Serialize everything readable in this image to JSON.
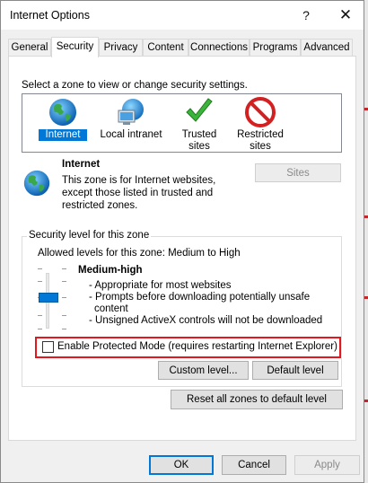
{
  "window": {
    "title": "Internet Options",
    "help_glyph": "?",
    "close_glyph": "✕"
  },
  "tabs": [
    {
      "label": "General",
      "active": false
    },
    {
      "label": "Security",
      "active": true
    },
    {
      "label": "Privacy",
      "active": false
    },
    {
      "label": "Content",
      "active": false
    },
    {
      "label": "Connections",
      "active": false
    },
    {
      "label": "Programs",
      "active": false
    },
    {
      "label": "Advanced",
      "active": false
    }
  ],
  "zone_prompt": "Select a zone to view or change security settings.",
  "zones": [
    {
      "label": "Internet",
      "icon": "globe-icon",
      "selected": true
    },
    {
      "label": "Local intranet",
      "icon": "network-computer-icon",
      "selected": false
    },
    {
      "label": "Trusted sites",
      "icon": "green-check-icon",
      "selected": false
    },
    {
      "label_line1": "Restricted",
      "label_line2": "sites",
      "icon": "no-entry-icon",
      "selected": false
    }
  ],
  "zone_info": {
    "title": "Internet",
    "line1": "This zone is for Internet websites,",
    "line2": "except those listed in trusted and",
    "line3": "restricted zones.",
    "icon": "globe-icon"
  },
  "sites_button": {
    "label": "Sites",
    "enabled": false
  },
  "security_level": {
    "group_title": "Security level for this zone",
    "allowed_label": "Allowed levels for this zone: Medium to High",
    "level_name": "Medium-high",
    "bullets": [
      "- Appropriate for most websites",
      "- Prompts before downloading potentially unsafe",
      "content",
      "- Unsigned ActiveX controls will not be downloaded"
    ]
  },
  "protected_mode": {
    "label": "Enable Protected Mode (requires restarting Internet Explorer)",
    "checked": false
  },
  "buttons": {
    "custom_level": "Custom level...",
    "default_level": "Default level",
    "reset_all": "Reset all zones to default level",
    "ok": "OK",
    "cancel": "Cancel",
    "apply": "Apply"
  },
  "colors": {
    "accent": "#0078d7",
    "highlight_border": "#e5171e"
  }
}
